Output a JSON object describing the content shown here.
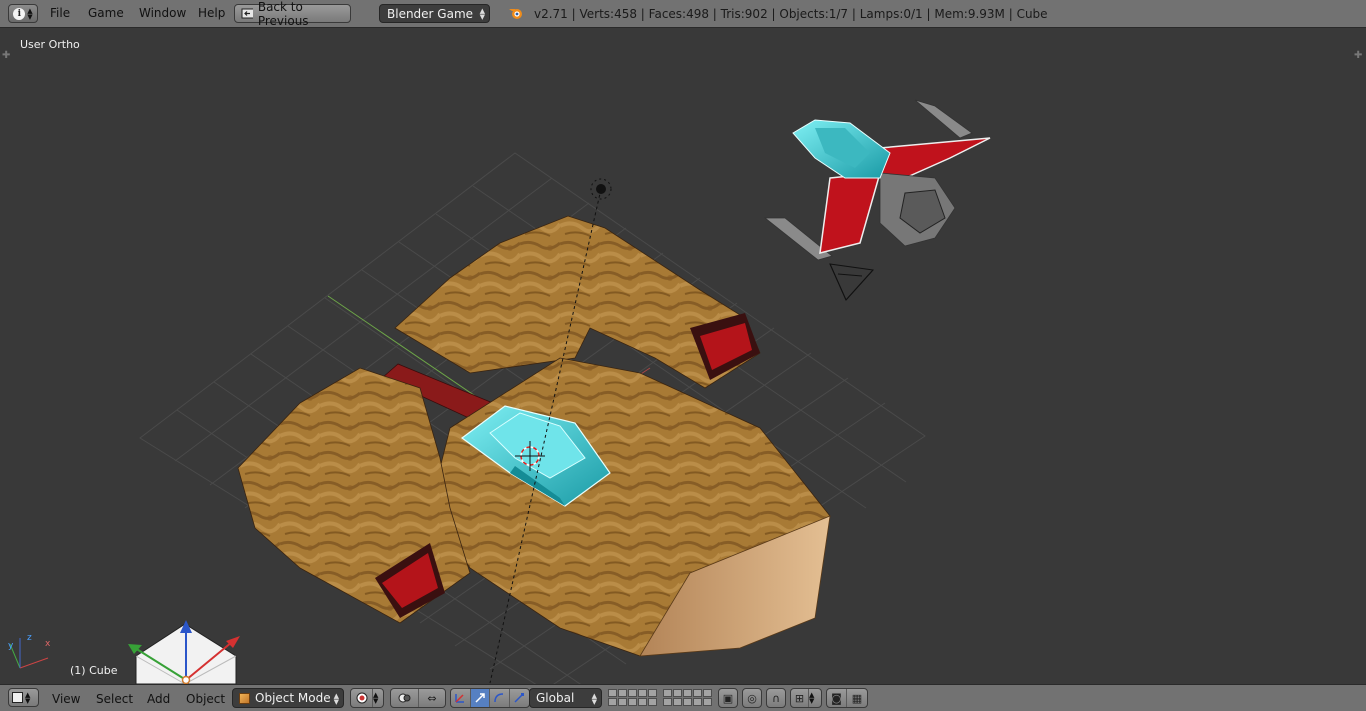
{
  "topbar": {
    "editor_icon": "info-icon",
    "menus": [
      "File",
      "Game",
      "Window",
      "Help"
    ],
    "back_button": "Back to Previous",
    "engine": "Blender Game",
    "stats": "v2.71 | Verts:458 | Faces:498 | Tris:902 | Objects:1/7 | Lamps:0/1 | Mem:9.93M | Cube"
  },
  "viewport": {
    "view_name": "User Ortho",
    "active_object": "(1) Cube"
  },
  "bottombar": {
    "editor_icon": "view3d-icon",
    "menus": [
      "View",
      "Select",
      "Add",
      "Object"
    ],
    "mode": "Object Mode",
    "orientation": "Global"
  },
  "colors": {
    "header_bg": "#727272",
    "viewport_bg": "#393939",
    "selection_cyan": "#3ad0d8",
    "ship_red": "#c0121c"
  }
}
